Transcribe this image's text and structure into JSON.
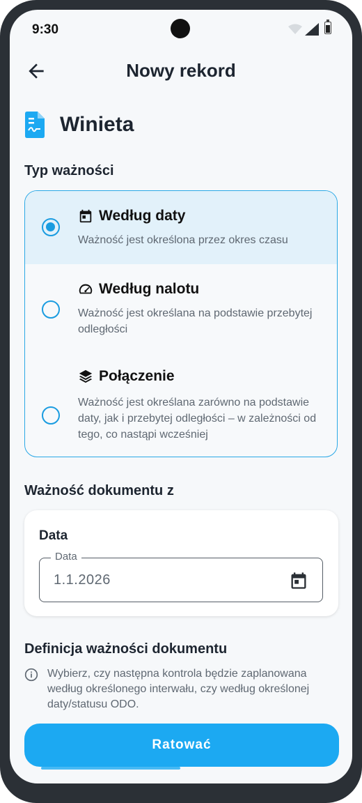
{
  "status_bar": {
    "time": "9:30"
  },
  "header": {
    "title": "Nowy rekord"
  },
  "document": {
    "name": "Winieta"
  },
  "validity_type": {
    "label": "Typ ważności",
    "options": [
      {
        "title": "Według daty",
        "description": "Ważność jest określona przez okres czasu",
        "selected": true,
        "icon": "calendar-icon"
      },
      {
        "title": "Według nalotu",
        "description": "Ważność jest określana na podstawie przebytej odległości",
        "selected": false,
        "icon": "speedometer-icon"
      },
      {
        "title": "Połączenie",
        "description": "Ważność jest określana zarówno na podstawie daty, jak i przebytej odległości – w zależności od tego, co nastąpi wcześniej",
        "selected": false,
        "icon": "layers-icon"
      }
    ]
  },
  "validity_from": {
    "label": "Ważność dokumentu z",
    "card_label": "Data",
    "field_label": "Data",
    "field_value": "1.1.2026"
  },
  "definition": {
    "label": "Definicja ważności dokumentu",
    "info": "Wybierz, czy następna kontrola będzie zaplanowana według określonego interwału, czy według określonej daty/statusu ODO."
  },
  "actions": {
    "save_label": "Ratować"
  },
  "colors": {
    "accent": "#1ca9f2",
    "selected_bg": "#e2f1fa",
    "border": "#2aa8e6"
  }
}
